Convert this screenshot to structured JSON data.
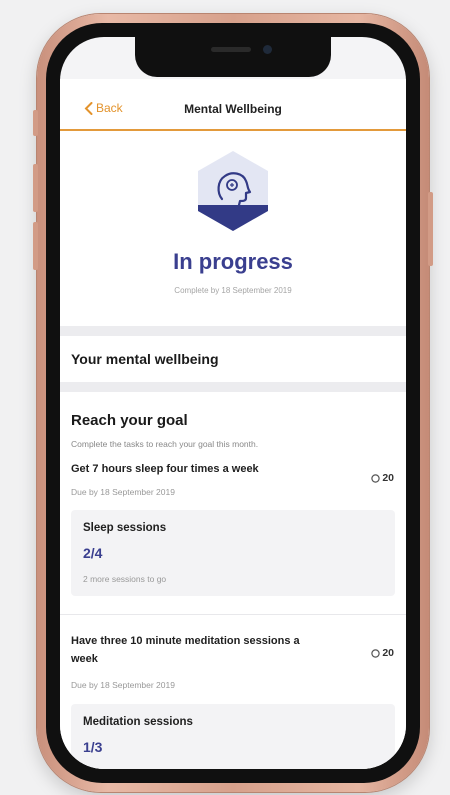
{
  "nav": {
    "back_label": "Back",
    "title": "Mental Wellbeing"
  },
  "hero": {
    "icon": "head-mind-icon",
    "status": "In progress",
    "complete_by": "Complete by 18 September 2019"
  },
  "wellbeing_section": {
    "title": "Your mental wellbeing"
  },
  "goal": {
    "title": "Reach your goal",
    "description": "Complete the tasks to reach your goal this month.",
    "tasks": [
      {
        "title": "Get 7 hours sleep four times a week",
        "due": "Due by 18 September 2019",
        "points": "20",
        "progress": {
          "label": "Sleep sessions",
          "count": "2/4",
          "note": "2 more sessions to go"
        }
      },
      {
        "title": "Have three 10 minute meditation sessions a week",
        "due": "Due by 18 September 2019",
        "points": "20",
        "progress": {
          "label": "Meditation sessions",
          "count": "1/3"
        }
      }
    ]
  },
  "colors": {
    "accent": "#e3932c",
    "brand": "#3a3f8f",
    "phone_frame": "#e3b09c"
  }
}
